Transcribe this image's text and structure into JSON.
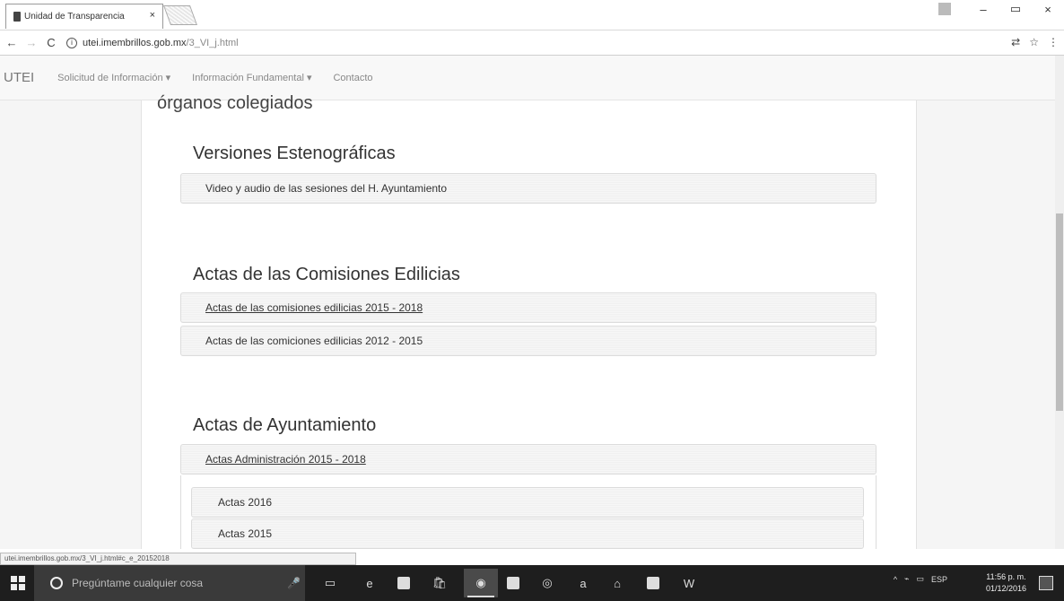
{
  "browser": {
    "tab_title": "Unidad de Transparencia",
    "tab_close": "×",
    "window_controls": [
      "–",
      "▭",
      "×"
    ],
    "url_host": "utei.imembrillos.gob.mx",
    "url_path": "/3_VI_j.html"
  },
  "site_nav": {
    "brand": "UTEI",
    "items": [
      "Solicitud de Información ▾",
      "Información Fundamental ▾",
      "Contacto"
    ]
  },
  "page": {
    "heading": "órganos colegiados",
    "sections": [
      {
        "title": "Versiones Estenográficas",
        "items": [
          "Video y audio de las sesiones del H. Ayuntamiento"
        ]
      },
      {
        "title": "Actas de las Comisiones Edilicias",
        "items": [
          "Actas de las comisiones edilicias 2015 - 2018",
          "Actas de las comiciones edilicias 2012 - 2015"
        ]
      },
      {
        "title": "Actas de Ayuntamiento",
        "items": [
          "Actas Administración 2015 - 2018"
        ],
        "subitems": [
          "Actas 2016",
          "Actas 2015"
        ]
      }
    ]
  },
  "status_url": "utei.imembrillos.gob.mx/3_VI_j.html#c_e_20152018",
  "taskbar": {
    "search_placeholder": "Pregúntame cualquier cosa",
    "language": "ESP",
    "time": "11:56 p. m.",
    "date": "01/12/2016"
  }
}
